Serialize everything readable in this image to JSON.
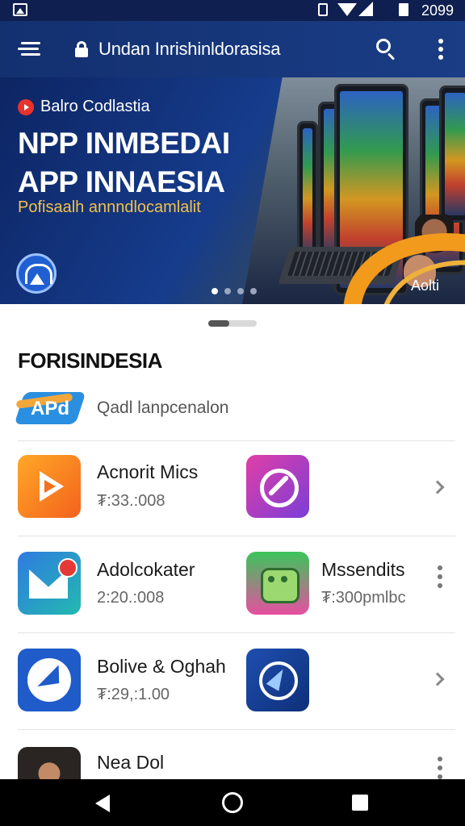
{
  "status_bar": {
    "time": "2099"
  },
  "app_bar": {
    "url": "Undan Inrishinldorasisa"
  },
  "banner": {
    "kicker": "Balro Codlastia",
    "title": "NPP INMBEDAI\nAPP INNAESIA",
    "subtitle": "Pofisaalh annndlocamlalit",
    "action": "Aolti",
    "slides": 4,
    "active_slide": 0,
    "colors": {
      "background": "#0d2563",
      "accent": "#f29a1c",
      "subtitle": "#f3c14a"
    }
  },
  "section": {
    "title": "FORISINDESIA",
    "brand_logo_text": "APd",
    "brand_label": "Qadl lanpcenalon"
  },
  "apps": [
    {
      "left": {
        "icon": "play-icon",
        "name": "Acnorit Mics",
        "price": "₮:33.:008"
      },
      "right": {
        "icon": "compass-icon",
        "name": "",
        "price": ""
      },
      "trailing": "chevron-right-icon"
    },
    {
      "left": {
        "icon": "mail-icon",
        "name": "Adolcokater",
        "price": "2:20.:008"
      },
      "right": {
        "icon": "robot-icon",
        "name": "Mssendits",
        "price": "₮:300pmlbc"
      },
      "trailing": "more-vert-icon"
    },
    {
      "left": {
        "icon": "plane-icon",
        "name": "Bolive & Oghah",
        "price": "₮:29,:1.00"
      },
      "right": {
        "icon": "navigation-icon",
        "name": "",
        "price": ""
      },
      "trailing": "chevron-right-icon"
    },
    {
      "left": {
        "icon": "person-icon",
        "name": "Nea Dol",
        "price": ""
      },
      "trailing": "more-vert-icon"
    }
  ]
}
